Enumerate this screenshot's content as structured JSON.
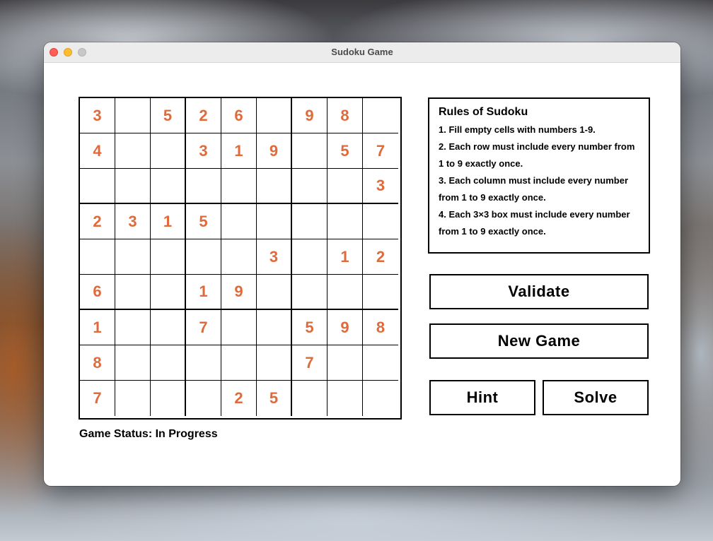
{
  "window": {
    "title": "Sudoku Game"
  },
  "board": {
    "rows": [
      [
        "3",
        "",
        "5",
        "2",
        "6",
        "",
        "9",
        "8",
        ""
      ],
      [
        "4",
        "",
        "",
        "3",
        "1",
        "9",
        "",
        "5",
        "7"
      ],
      [
        "",
        "",
        "",
        "",
        "",
        "",
        "",
        "",
        "3"
      ],
      [
        "2",
        "3",
        "1",
        "5",
        "",
        "",
        "",
        "",
        ""
      ],
      [
        "",
        "",
        "",
        "",
        "",
        "3",
        "",
        "1",
        "2"
      ],
      [
        "6",
        "",
        "",
        "1",
        "9",
        "",
        "",
        "",
        ""
      ],
      [
        "1",
        "",
        "",
        "7",
        "",
        "",
        "5",
        "9",
        "8"
      ],
      [
        "8",
        "",
        "",
        "",
        "",
        "",
        "7",
        "",
        ""
      ],
      [
        "7",
        "",
        "",
        "",
        "2",
        "5",
        "",
        "",
        ""
      ]
    ],
    "number_color": "#e06a3a"
  },
  "rules": {
    "title": "Rules of Sudoku",
    "items": [
      "1. Fill empty cells with numbers 1-9.",
      "2. Each row must include every number from 1 to 9 exactly once.",
      "3. Each column must include every number from 1 to 9 exactly once.",
      "4. Each 3×3 box must include every number from 1 to 9 exactly once."
    ]
  },
  "buttons": {
    "validate": "Validate",
    "new_game": "New Game",
    "hint": "Hint",
    "solve": "Solve"
  },
  "status": {
    "text": "Game Status: In Progress"
  }
}
